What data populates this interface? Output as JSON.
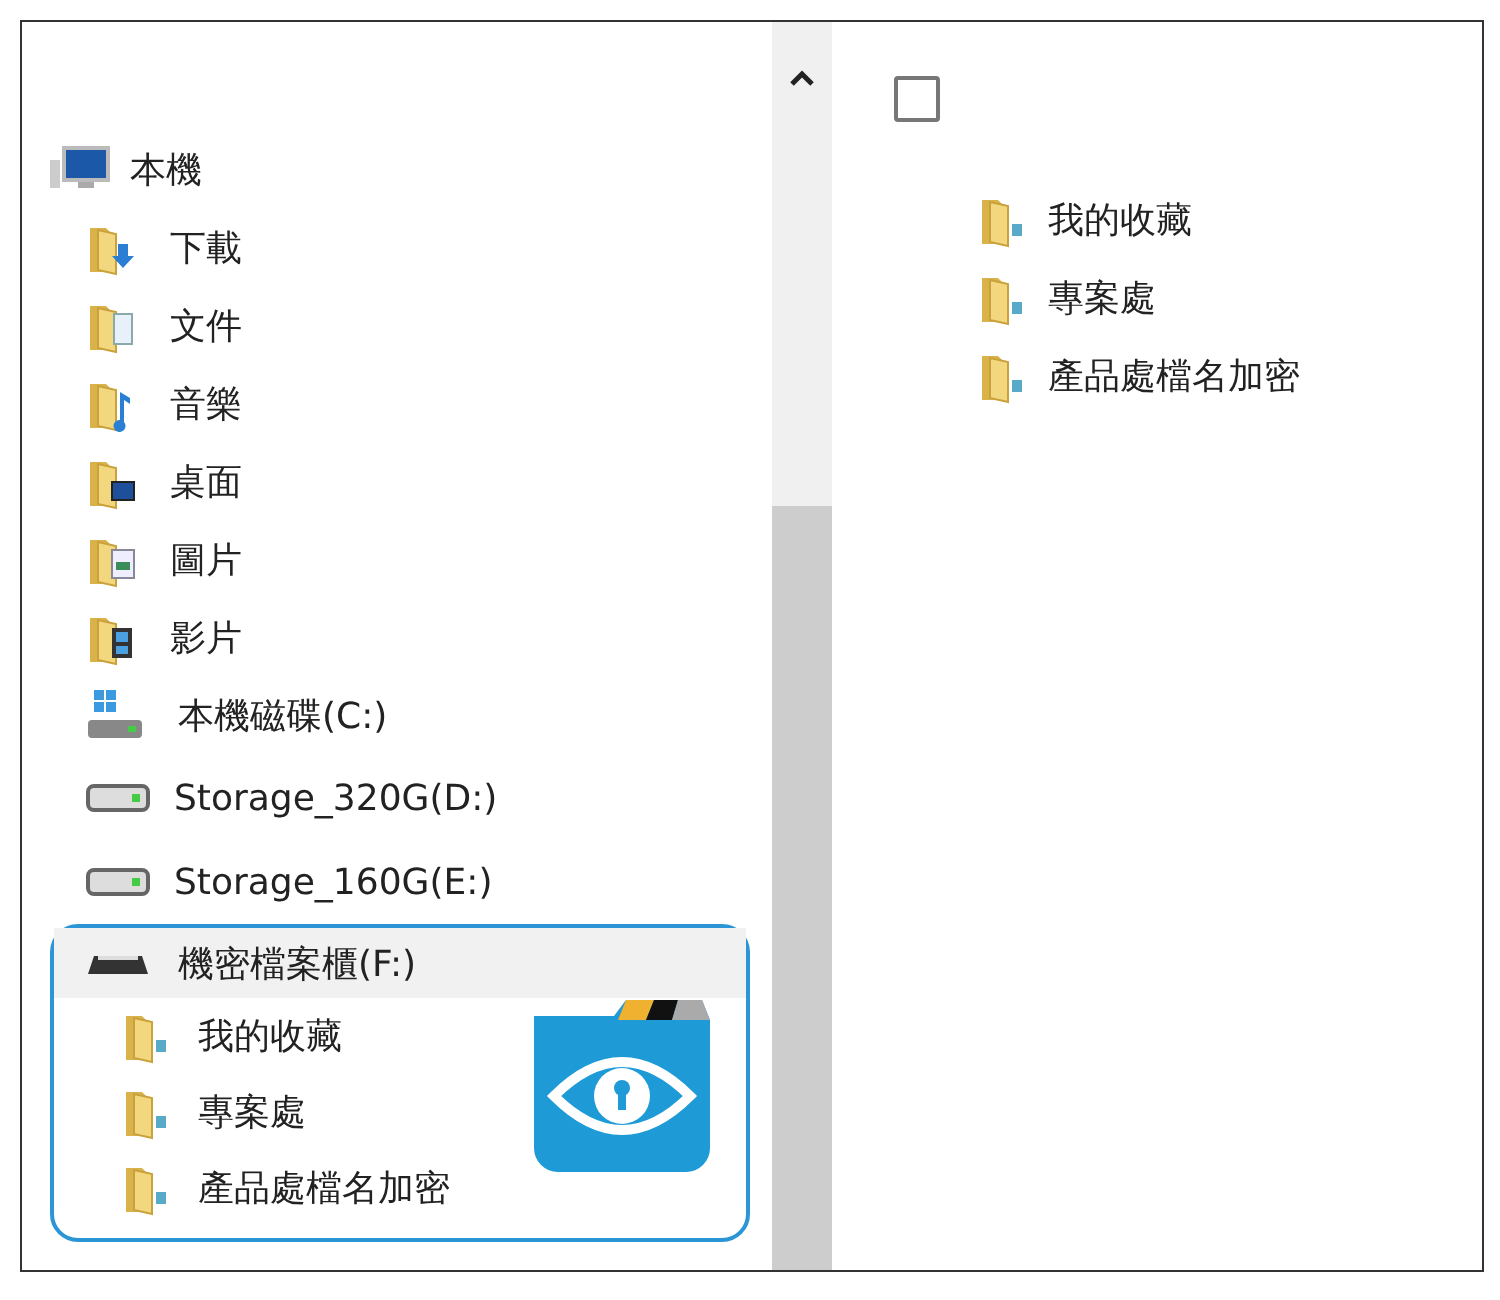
{
  "nav_tree": [
    {
      "label": "本機",
      "kind": "computer",
      "selected": false,
      "children": [
        {
          "label": "下載",
          "kind": "downloads",
          "selected": false
        },
        {
          "label": "文件",
          "kind": "documents",
          "selected": false
        },
        {
          "label": "音樂",
          "kind": "music",
          "selected": false
        },
        {
          "label": "桌面",
          "kind": "desktop",
          "selected": false
        },
        {
          "label": "圖片",
          "kind": "pictures",
          "selected": false
        },
        {
          "label": "影片",
          "kind": "videos",
          "selected": false
        },
        {
          "label": "本機磁碟(C:)",
          "kind": "systemdrive",
          "selected": false
        },
        {
          "label": "Storage_320G(D:)",
          "kind": "drive",
          "selected": false
        },
        {
          "label": "Storage_160G(E:)",
          "kind": "drive",
          "selected": false
        },
        {
          "label": "機密檔案櫃(F:)",
          "kind": "securedrive",
          "selected": true,
          "highlighted": true,
          "children": [
            {
              "label": "我的收藏",
              "kind": "folder",
              "selected": false
            },
            {
              "label": "專案處",
              "kind": "folder",
              "selected": false
            },
            {
              "label": "產品處檔名加密",
              "kind": "folder",
              "selected": false
            }
          ]
        }
      ]
    }
  ],
  "content": {
    "select_all": {
      "checked": false
    },
    "items": [
      {
        "label": "我的收藏",
        "selected": false
      },
      {
        "label": "專案處",
        "selected": false
      },
      {
        "label": "產品處檔名加密",
        "selected": false
      }
    ]
  }
}
